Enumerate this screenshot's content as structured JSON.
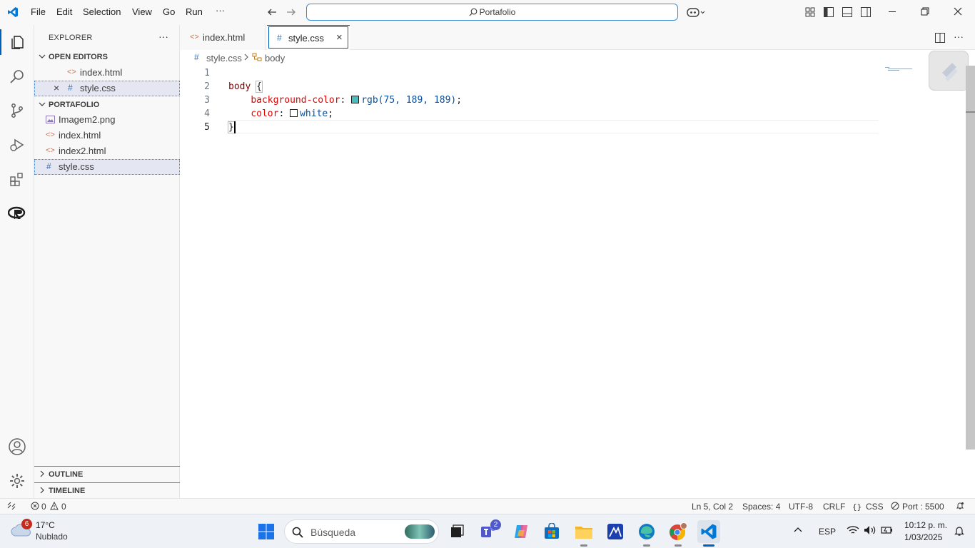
{
  "titlebar": {
    "menu": [
      "File",
      "Edit",
      "Selection",
      "View",
      "Go",
      "Run",
      "···"
    ],
    "search": "Portafolio"
  },
  "sidebar": {
    "title": "EXPLORER",
    "more": "···",
    "open_editors": {
      "header": "OPEN EDITORS",
      "items": [
        {
          "icon": "<>",
          "name": "index.html"
        },
        {
          "icon": "#",
          "name": "style.css",
          "close": "×"
        }
      ]
    },
    "folder": {
      "header": "PORTAFOLIO",
      "items": [
        {
          "icon": "image-icon",
          "name": "Imagem2.png"
        },
        {
          "icon": "<>",
          "name": "index.html"
        },
        {
          "icon": "<>",
          "name": "index2.html"
        },
        {
          "icon": "#",
          "name": "style.css"
        }
      ]
    },
    "outline": "OUTLINE",
    "timeline": "TIMELINE"
  },
  "tabs": [
    {
      "icon": "<>",
      "name": "index.html"
    },
    {
      "icon": "#",
      "name": "style.css",
      "close": "×"
    }
  ],
  "breadcrumb": {
    "file_icon": "#",
    "file": "style.css",
    "symbol": "body"
  },
  "editor": {
    "line_numbers": [
      "1",
      "2",
      "3",
      "4",
      "5"
    ],
    "lines": {
      "l2_selector": "body",
      "l2_brace": "{",
      "l3_prop": "background-color",
      "l3_value": "rgb(75, 189, 189)",
      "l4_prop": "color",
      "l4_value": "white",
      "l5_brace": "}"
    },
    "swatch_colors": {
      "teal": "#4bbdbd",
      "white": "#ffffff"
    }
  },
  "statusbar": {
    "errors": "0",
    "warnings": "0",
    "position": "Ln 5, Col 2",
    "spaces": "Spaces: 4",
    "encoding": "UTF-8",
    "eol": "CRLF",
    "language": "CSS",
    "port": "Port : 5500"
  },
  "taskbar": {
    "weather_temp": "17°C",
    "weather_desc": "Nublado",
    "weather_badge": "6",
    "search_placeholder": "Búsqueda",
    "teams_badge": "2",
    "lang": "ESP",
    "time": "10:12 p. m.",
    "date": "1/03/2025"
  },
  "colors": {
    "accent": "#005fb8",
    "vscode_blue": "#0078d4"
  }
}
